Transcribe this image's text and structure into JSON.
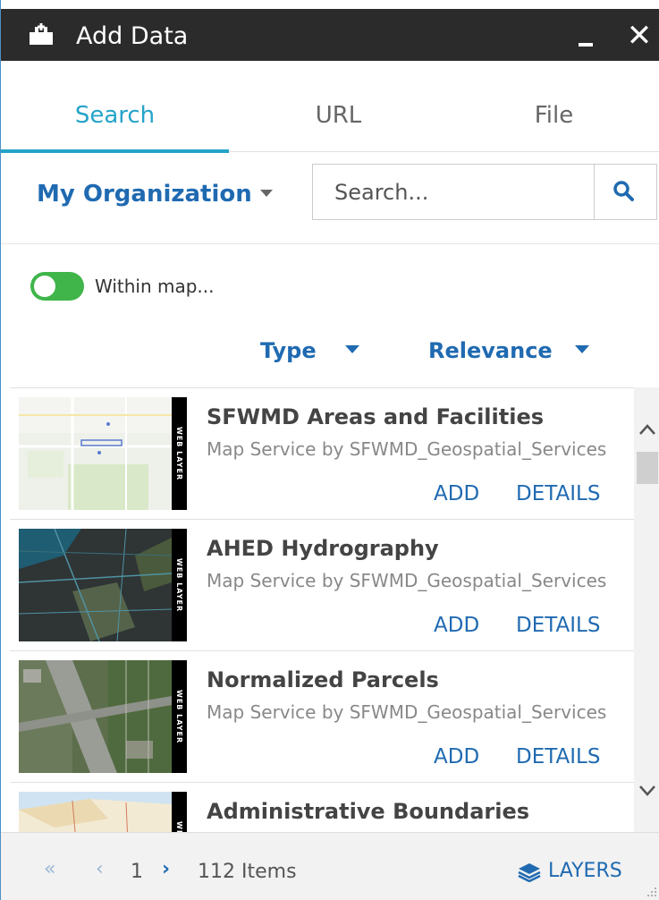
{
  "window": {
    "title": "Add Data",
    "icon": "add-data-icon",
    "minimize_icon": "minimize-icon",
    "close_icon": "close-icon",
    "close_glyph": "✕"
  },
  "tabs": [
    {
      "label": "Search",
      "active": true
    },
    {
      "label": "URL",
      "active": false
    },
    {
      "label": "File",
      "active": false
    }
  ],
  "scope": {
    "label": "My Organization"
  },
  "search": {
    "placeholder": "Search...",
    "value": ""
  },
  "filter": {
    "within_map_label": "Within map...",
    "within_map_on": true
  },
  "sort": {
    "type_label": "Type",
    "order_label": "Relevance"
  },
  "items": [
    {
      "title": "SFWMD Areas and Facilities",
      "subtitle": "Map Service by SFWMD_Geospatial_Services",
      "badge": "WEB LAYER",
      "add_label": "ADD",
      "details_label": "DETAILS"
    },
    {
      "title": "AHED Hydrography",
      "subtitle": "Map Service by SFWMD_Geospatial_Services",
      "badge": "WEB LAYER",
      "add_label": "ADD",
      "details_label": "DETAILS"
    },
    {
      "title": "Normalized Parcels",
      "subtitle": "Map Service by SFWMD_Geospatial_Services",
      "badge": "WEB LAYER",
      "add_label": "ADD",
      "details_label": "DETAILS"
    },
    {
      "title": "Administrative Boundaries",
      "subtitle": "",
      "badge": "WEB LAYER",
      "add_label": "",
      "details_label": ""
    }
  ],
  "footer": {
    "first_glyph": "«",
    "prev_glyph": "‹",
    "page": "1",
    "next_glyph": "›",
    "count": "112 Items",
    "layers_label": "LAYERS"
  },
  "colors": {
    "accent": "#24a3c9",
    "link": "#1f6ab1",
    "titlebar": "#2b2b2b",
    "toggle_on": "#3fb54a"
  }
}
